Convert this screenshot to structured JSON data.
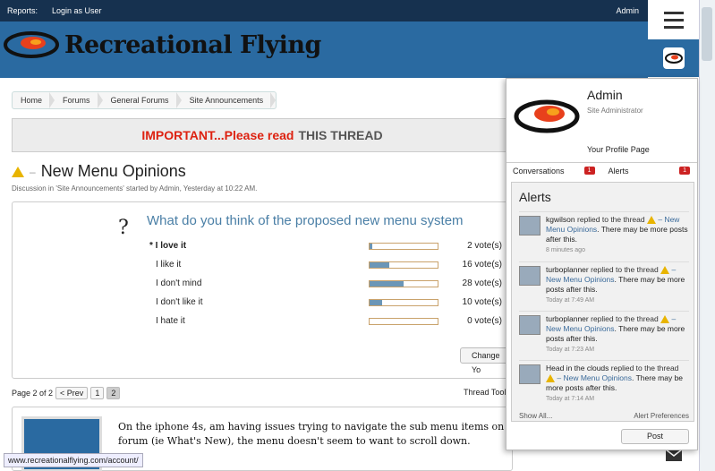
{
  "topbar": {
    "reports": "Reports:",
    "login": "Login as User",
    "admin": "Admin"
  },
  "site": {
    "name": "Recreational Flying"
  },
  "breadcrumb": [
    "Home",
    "Forums",
    "General Forums",
    "Site Announcements"
  ],
  "notice": {
    "important": "IMPORTANT...Please read",
    "thread": "THIS THREAD"
  },
  "thread": {
    "title": "New Menu Opinions",
    "meta": "Discussion in 'Site Announcements' started by Admin, Yesterday at 10:22 AM."
  },
  "poll": {
    "question": "What do you think of the proposed new menu system",
    "mark": "?",
    "options": [
      {
        "label": "* I love it",
        "votes": "2 vote(s)",
        "fraction": 0.04
      },
      {
        "label": "I like it",
        "votes": "16 vote(s)",
        "fraction": 0.29
      },
      {
        "label": "I don't mind",
        "votes": "28 vote(s)",
        "fraction": 0.5
      },
      {
        "label": "I don't like it",
        "votes": "10 vote(s)",
        "fraction": 0.18
      },
      {
        "label": "I hate it",
        "votes": "0 vote(s)",
        "fraction": 0
      }
    ],
    "change_vote": "Change Yo"
  },
  "pagenav": {
    "label": "Page 2 of 2",
    "prev": "< Prev",
    "p1": "1",
    "p2": "2"
  },
  "thread_tools": "Thread Tools",
  "post": {
    "text": "On the iphone 4s, am having issues trying to navigate the sub menu items on forum (ie What's New), the menu doesn't seem to want to scroll down."
  },
  "statusbar": "www.recreationalflying.com/account/",
  "panel": {
    "name": "Admin",
    "title": "Site Administrator",
    "profile": "Your Profile Page",
    "tabs": [
      {
        "label": "Conversations",
        "badge": "1"
      },
      {
        "label": "Alerts",
        "badge": "1"
      }
    ],
    "alerts_head": "Alerts",
    "alerts": [
      {
        "user": "kgwilson",
        "action": "replied to the thread",
        "thread": "– New Menu Opinions",
        "rest": ". There may be more posts after this.",
        "time": "8 minutes ago"
      },
      {
        "user": "turboplanner",
        "action": "replied to the thread",
        "thread": "– New Menu Opinions",
        "rest": ". There may be more posts after this.",
        "time": "Today at 7:49 AM"
      },
      {
        "user": "turboplanner",
        "action": "replied to the thread",
        "thread": "– New Menu Opinions",
        "rest": ". There may be more posts after this.",
        "time": "Today at 7:23 AM"
      },
      {
        "user": "Head in the clouds",
        "action": "replied to the thread",
        "thread": "– New Menu Opinions",
        "rest": ". There may be more posts after this.",
        "time": "Today at 7:14 AM"
      }
    ],
    "show_all": "Show All...",
    "prefs": "Alert Preferences",
    "post_btn": "Post"
  },
  "colors": {
    "header": "#2a6aa1",
    "topbar": "#16314f",
    "important": "#d21",
    "bar_fill": "#6b96b7"
  },
  "icons": {
    "menu": "hamburger-icon",
    "warning": "warning-icon",
    "mail": "mail-icon"
  }
}
